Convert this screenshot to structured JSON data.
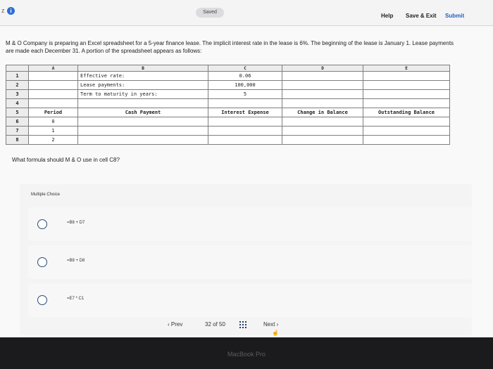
{
  "header": {
    "quiz_abbr": "z",
    "info_icon": "i",
    "saved": "Saved",
    "help": "Help",
    "save_exit": "Save & Exit",
    "submit": "Submit"
  },
  "question": {
    "prompt": "M & O Company is preparing an Excel spreadsheet for a 5-year finance lease. The implicit interest rate in the lease is 6%. The beginning of the lease is January 1. Lease payments are made each December 31. A portion of the spreadsheet appears as follows:",
    "ask": "What formula should M & O use in cell C8?"
  },
  "spreadsheet": {
    "columns": [
      "",
      "A",
      "B",
      "C",
      "D",
      "E"
    ],
    "rows": [
      {
        "n": "1",
        "a": "",
        "b": "Effective rate:",
        "c": "0.06",
        "d": "",
        "e": ""
      },
      {
        "n": "2",
        "a": "",
        "b": "Lease payments:",
        "c": "100,000",
        "d": "",
        "e": ""
      },
      {
        "n": "3",
        "a": "",
        "b": "Term to maturity in years:",
        "c": "5",
        "d": "",
        "e": ""
      },
      {
        "n": "4",
        "a": "",
        "b": "",
        "c": "",
        "d": "",
        "e": ""
      },
      {
        "n": "5",
        "a": "Period",
        "b": "Cash Payment",
        "c": "Interest Expense",
        "d": "Change in Balance",
        "e": "Outstanding Balance"
      },
      {
        "n": "6",
        "a": "0",
        "b": "",
        "c": "",
        "d": "",
        "e": ""
      },
      {
        "n": "7",
        "a": "1",
        "b": "",
        "c": "",
        "d": "",
        "e": ""
      },
      {
        "n": "8",
        "a": "2",
        "b": "",
        "c": "",
        "d": "",
        "e": ""
      }
    ]
  },
  "multiple_choice": {
    "title": "Multiple Choice",
    "options": [
      "=B8 + D7",
      "=B8 + D8",
      "=E7 * C1"
    ]
  },
  "nav": {
    "prev": "‹ Prev",
    "page_current": "32",
    "page_of": "of",
    "page_total": "50",
    "next": "Next ›",
    "grid_icon": "grid-icon",
    "cursor": "☝"
  },
  "device": {
    "bezel_label": "MacBook Pro"
  }
}
